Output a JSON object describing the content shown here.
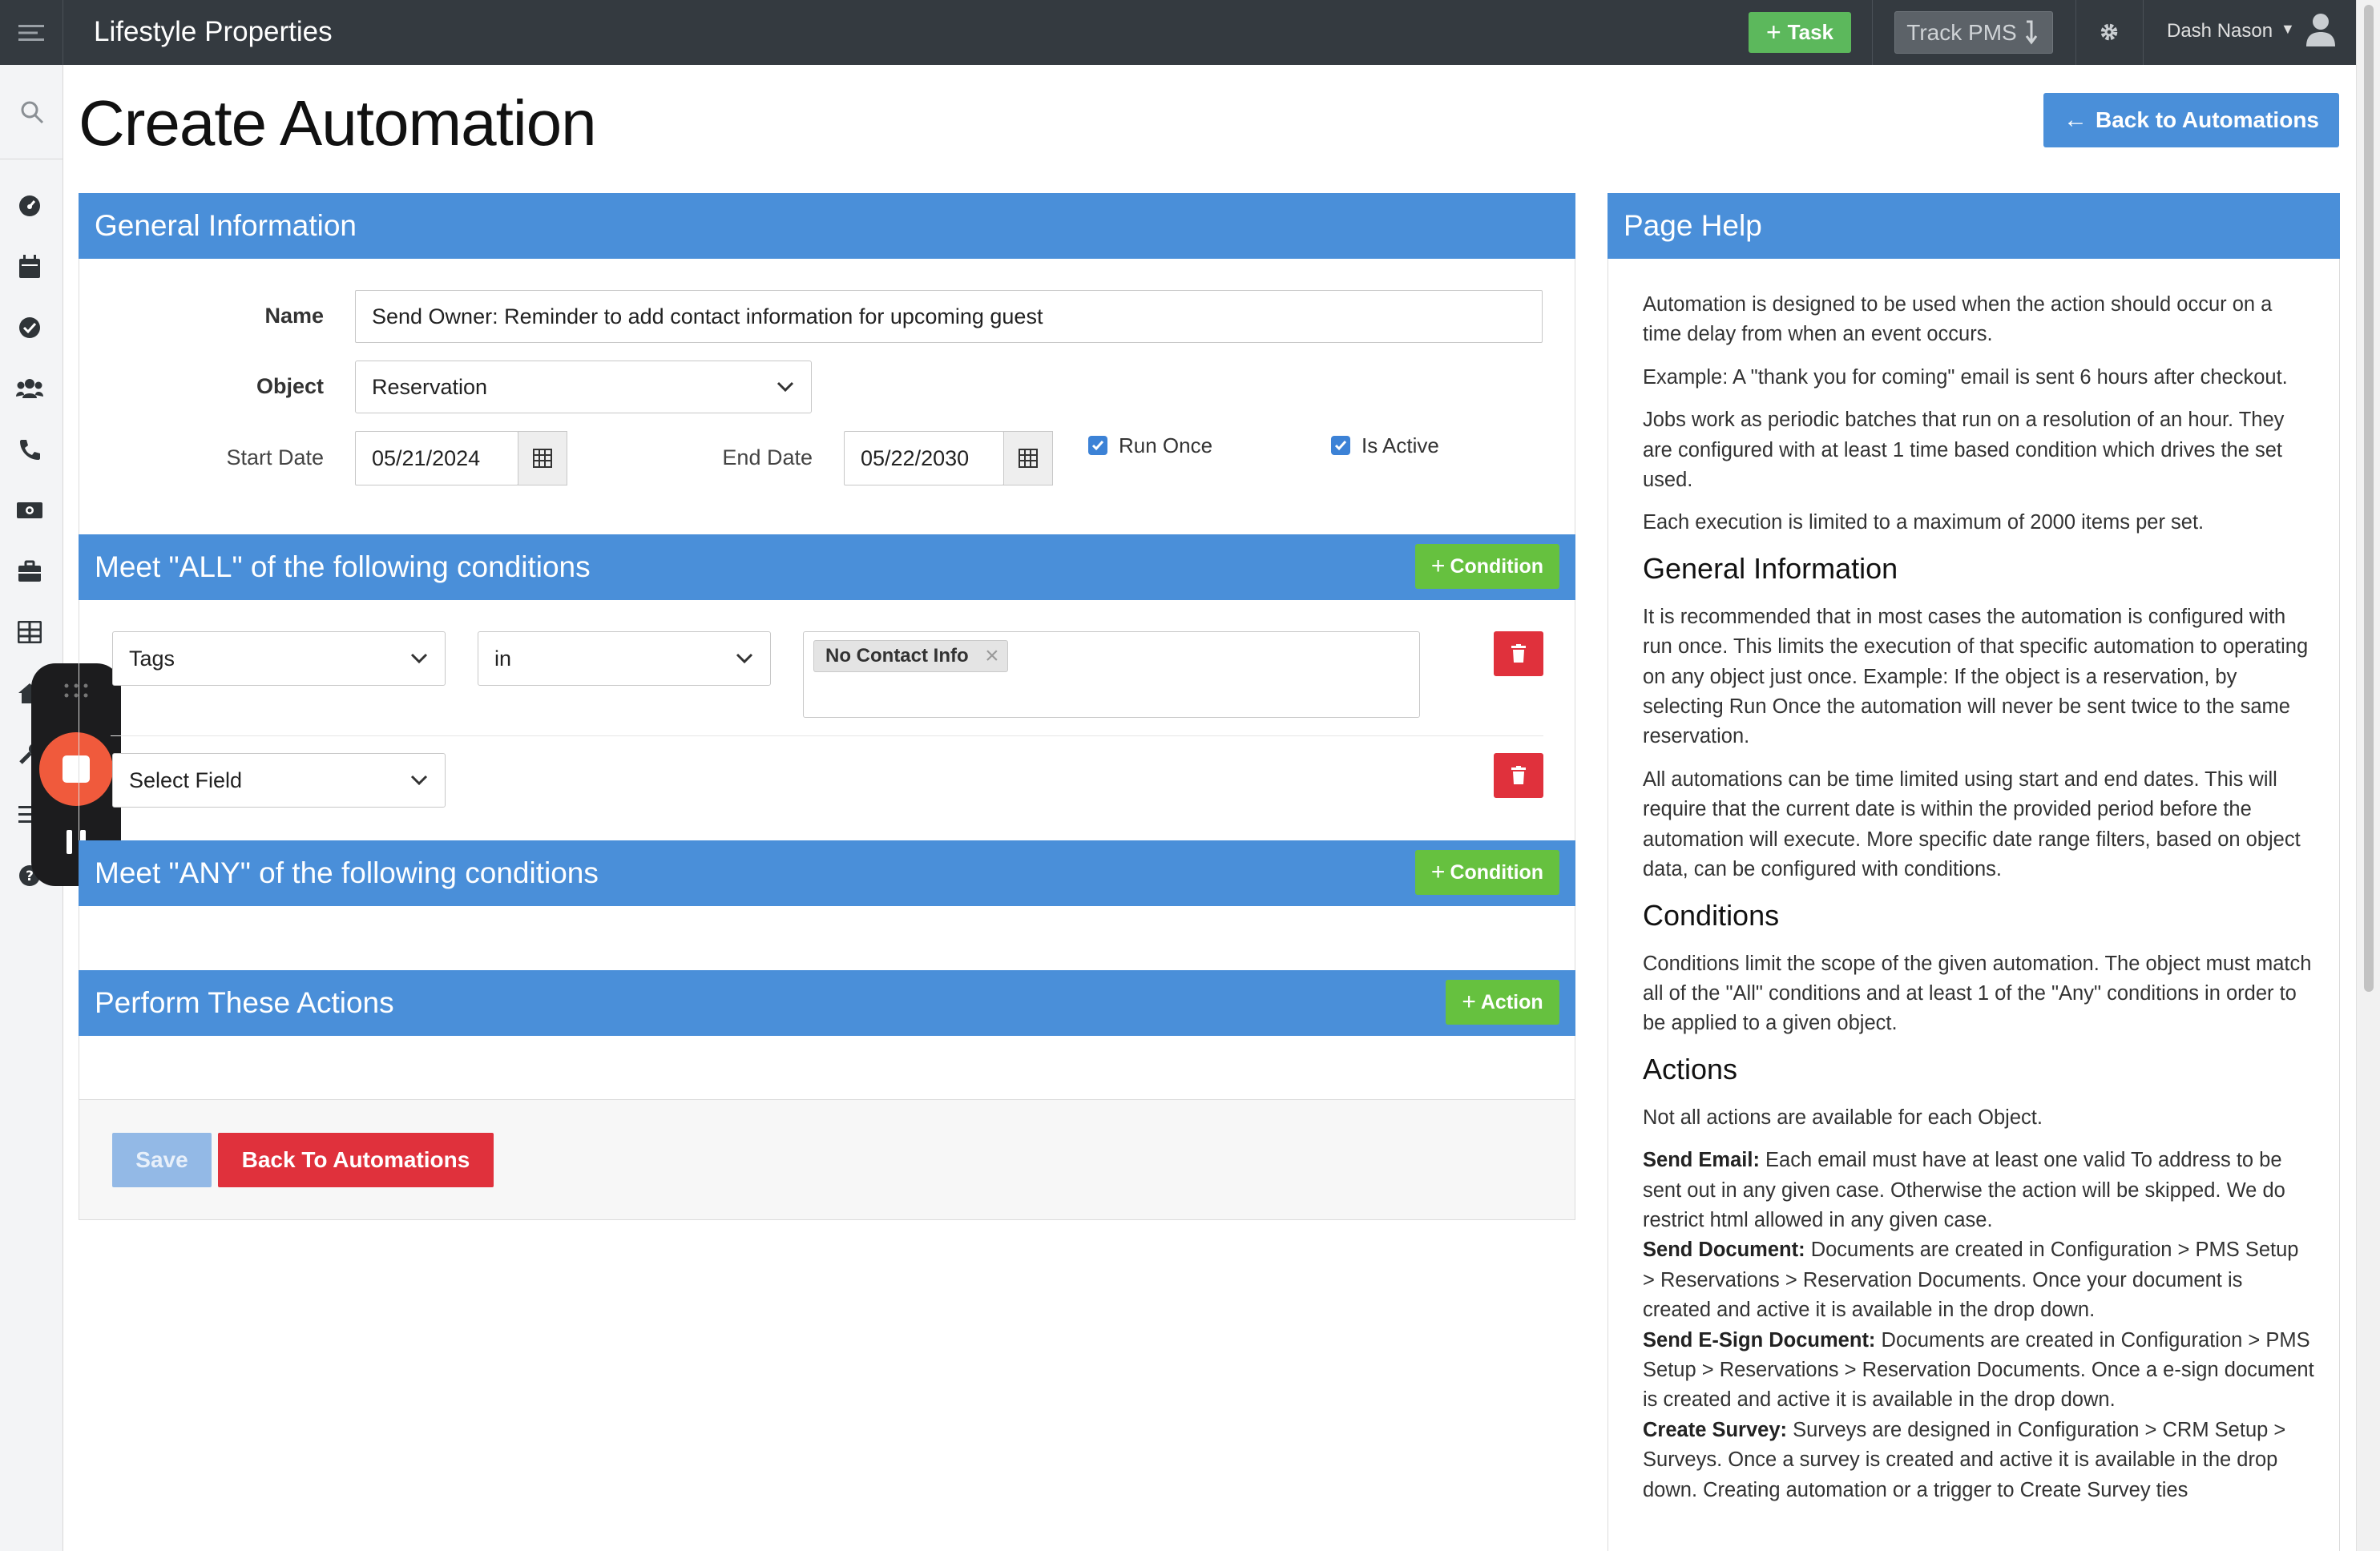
{
  "app": {
    "title": "Lifestyle Properties",
    "task_button": "Task",
    "track_button": "Track PMS",
    "user_name": "Dash Nason"
  },
  "page": {
    "title": "Create Automation",
    "back_button": "Back to Automations"
  },
  "general": {
    "header": "General Information",
    "name_label": "Name",
    "name_value": "Send Owner: Reminder to add contact information for upcoming guest",
    "object_label": "Object",
    "object_value": "Reservation",
    "start_label": "Start Date",
    "start_value": "05/21/2024",
    "end_label": "End Date",
    "end_value": "05/22/2030",
    "run_once_label": "Run Once",
    "is_active_label": "Is Active"
  },
  "all_conditions": {
    "header": "Meet \"ALL\" of the following conditions",
    "add_button": "Condition",
    "rows": [
      {
        "field": "Tags",
        "operator": "in",
        "tag": "No Contact Info"
      },
      {
        "field": "Select Field"
      }
    ]
  },
  "any_conditions": {
    "header": "Meet \"ANY\" of the following conditions",
    "add_button": "Condition"
  },
  "actions": {
    "header": "Perform These Actions",
    "add_button": "Action"
  },
  "footer": {
    "save": "Save",
    "back": "Back To Automations"
  },
  "help": {
    "header": "Page Help",
    "intro": [
      "Automation is designed to be used when the action should occur on a time delay from when an event occurs.",
      "Example: A \"thank you for coming\" email is sent 6 hours after checkout.",
      "Jobs work as periodic batches that run on a resolution of an hour. They are configured with at least 1 time based condition which drives the set used.",
      "Each execution is limited to a maximum of 2000 items per set."
    ],
    "general_title": "General Information",
    "general": [
      "It is recommended that in most cases the automation is configured with run once. This limits the execution of that specific automation to operating on any object just once. Example: If the object is a reservation, by selecting Run Once the automation will never be sent twice to the same reservation.",
      "All automations can be time limited using start and end dates. This will require that the current date is within the provided period before the automation will execute. More specific date range filters, based on object data, can be configured with conditions."
    ],
    "conditions_title": "Conditions",
    "conditions": "Conditions limit the scope of the given automation. The object must match all of the \"All\" conditions and at least 1 of the \"Any\" conditions in order to be applied to a given object.",
    "actions_title": "Actions",
    "actions_intro": "Not all actions are available for each Object.",
    "items": [
      {
        "term": "Send Email:",
        "desc": "Each email must have at least one valid To address to be sent out in any given case. Otherwise the action will be skipped. We do restrict html allowed in any given case."
      },
      {
        "term": "Send Document:",
        "desc": "Documents are created in Configuration > PMS Setup > Reservations > Reservation Documents. Once your document is created and active it is available in the drop down."
      },
      {
        "term": "Send E-Sign Document:",
        "desc": "Documents are created in Configuration > PMS Setup > Reservations > Reservation Documents. Once a e-sign document is created and active it is available in the drop down."
      },
      {
        "term": "Create Survey:",
        "desc": "Surveys are designed in Configuration > CRM Setup > Surveys. Once a survey is created and active it is available in the drop down. Creating automation or a trigger to Create Survey ties"
      }
    ]
  }
}
